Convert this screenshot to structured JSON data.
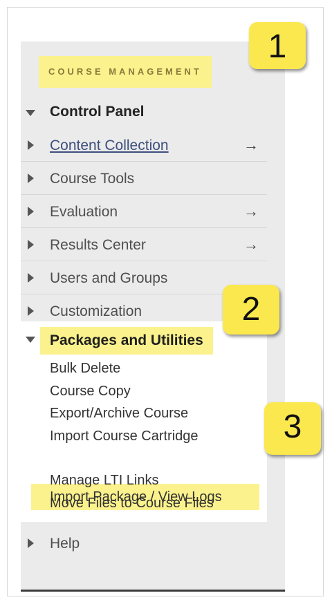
{
  "panel": {
    "header": "COURSE MANAGEMENT",
    "control_panel": "Control Panel",
    "items": [
      {
        "label": "Content Collection",
        "arrow": "→"
      },
      {
        "label": "Course Tools",
        "arrow": ""
      },
      {
        "label": "Evaluation",
        "arrow": "→"
      },
      {
        "label": "Results Center",
        "arrow": "→"
      },
      {
        "label": "Users and Groups",
        "arrow": ""
      },
      {
        "label": "Customization",
        "arrow": ""
      }
    ],
    "packages": {
      "label": "Packages and Utilities",
      "subitems": [
        "Bulk Delete",
        "Course Copy",
        "Export/Archive Course",
        "Import Course Cartridge",
        "Import Package / View Logs",
        "Manage LTI Links",
        "Move Files to Course Files"
      ]
    },
    "help": "Help"
  },
  "callouts": [
    "1",
    "2",
    "3"
  ],
  "colors": {
    "highlight": "#fbf28d",
    "badge": "#fbe84e",
    "panel_bg": "#ebebeb"
  },
  "icons": {
    "collapsed": "triangle-right-icon",
    "expanded": "triangle-down-icon",
    "navigate": "arrow-right-icon"
  }
}
